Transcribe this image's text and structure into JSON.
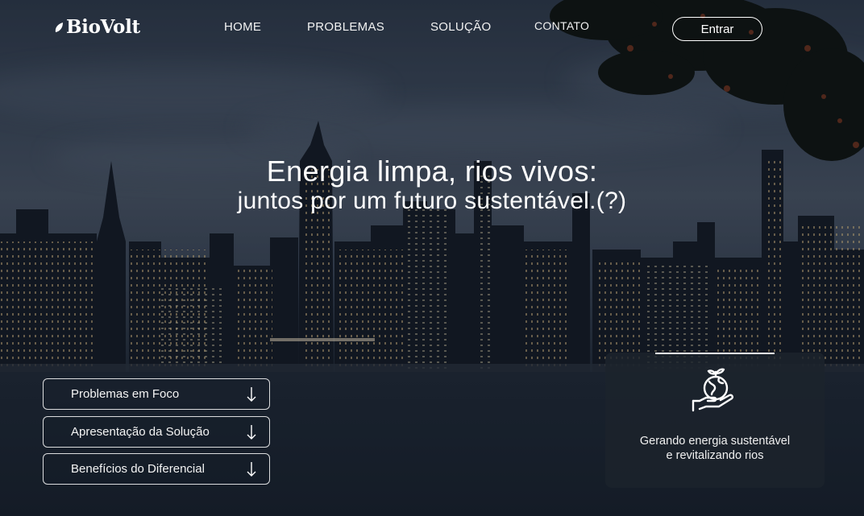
{
  "header": {
    "logo_text": "BioVolt",
    "nav": [
      "HOME",
      "PROBLEMAS",
      "SOLUÇÃO",
      "CONTATO"
    ],
    "login_label": "Entrar"
  },
  "hero": {
    "line1": "Energia limpa, rios vivos:",
    "line2": "juntos por um futuro sustentável.(?)"
  },
  "menu": [
    "Problemas em Foco",
    "Apresentação da Solução",
    "Benefícios do Diferencial"
  ],
  "card": {
    "icon": "plant-in-hand-icon",
    "caption_line1": "Gerando energia sustentável",
    "caption_line2": "e revitalizando rios"
  }
}
